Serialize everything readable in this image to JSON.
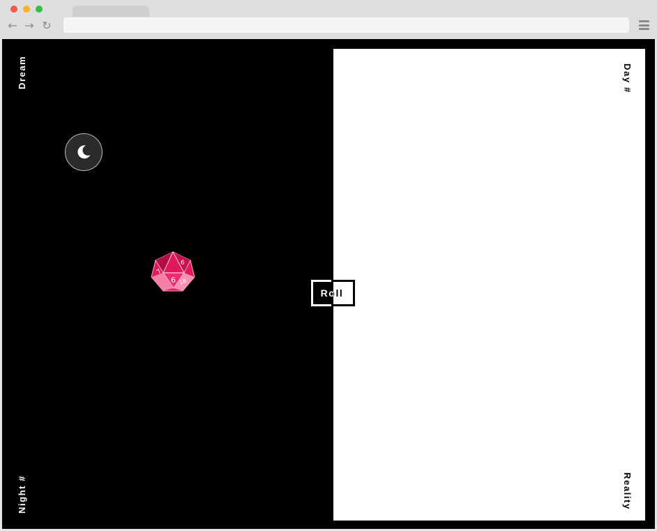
{
  "browser": {
    "back_icon": "arrow-left-icon",
    "forward_icon": "arrow-right-icon",
    "reload_icon": "reload-icon",
    "menu_icon": "hamburger-menu-icon",
    "url": ""
  },
  "night_side": {
    "top_label": "Dream",
    "bottom_label": "Night  #",
    "background": "#000000",
    "theme_toggle_icon": "moon-icon"
  },
  "day_side": {
    "top_label": "Day  #",
    "bottom_label": "Reality",
    "background": "#ffffff"
  },
  "dice": {
    "icon": "d20-dice-icon",
    "color": "#e0185e",
    "faces": [
      "6",
      "9",
      "7",
      "18"
    ]
  },
  "roll_button": {
    "label": "Roll"
  }
}
